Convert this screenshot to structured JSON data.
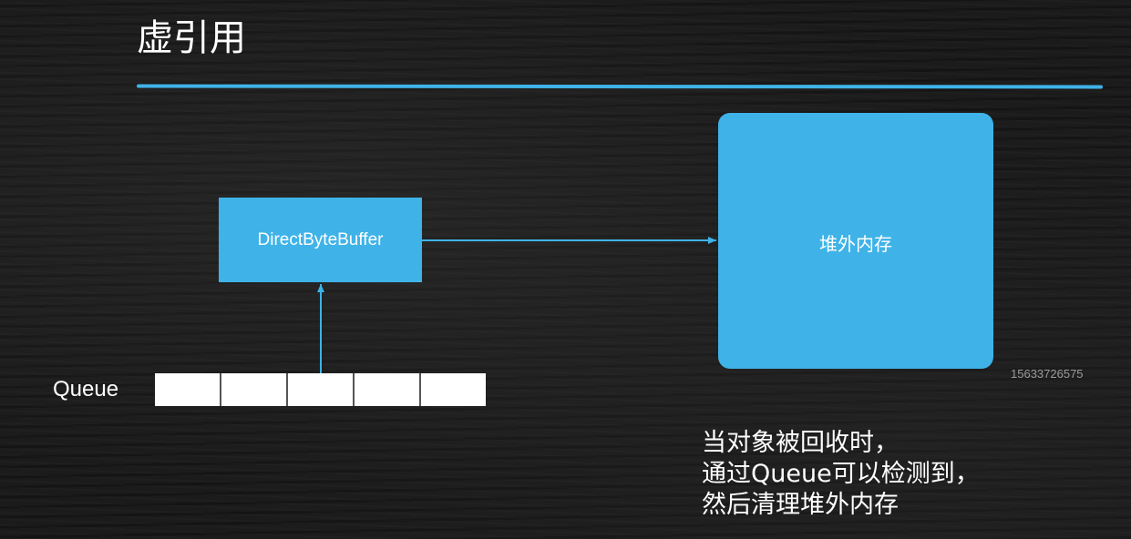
{
  "title": "虚引用",
  "diagram": {
    "direct_byte_buffer": "DirectByteBuffer",
    "off_heap_memory": "堆外内存",
    "queue_label": "Queue",
    "queue_slot_count": 5
  },
  "watermark": "15633726575",
  "caption": {
    "line1": "当对象被回收时，",
    "line2": "通过Queue可以检测到，",
    "line3": "然后清理堆外内存"
  },
  "colors": {
    "accent": "#3fb3e8",
    "background": "#1b1b1b",
    "text": "#ffffff"
  }
}
